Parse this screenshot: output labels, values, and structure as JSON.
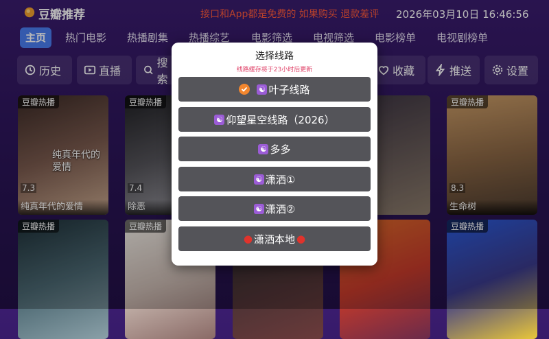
{
  "header": {
    "app_title": "豆瓣推荐",
    "notice": "接口和App都是免费的 如果购买 退款差评",
    "clock": "2026年03月10日 16:46:56"
  },
  "nav": {
    "tabs": [
      "主页",
      "热门电影",
      "热播剧集",
      "热播综艺",
      "电影筛选",
      "电视筛选",
      "电影榜单",
      "电视剧榜单"
    ]
  },
  "toolbar": {
    "history": "历史",
    "live": "直播",
    "search": "搜索",
    "favorite": "收藏",
    "push": "推送",
    "settings": "设置"
  },
  "cards": {
    "row1": [
      {
        "tag": "豆瓣热播",
        "score": "7.3",
        "name": "纯真年代的爱情",
        "poster_text": "纯真年代的爱情"
      },
      {
        "tag": "豆瓣热播",
        "score": "7.4",
        "name": "除恶",
        "poster_text": ""
      },
      {
        "tag": "",
        "score": "",
        "name": "",
        "poster_text": ""
      },
      {
        "tag": "",
        "score": "",
        "name": "",
        "poster_text": ""
      },
      {
        "tag": "",
        "score": "",
        "name": "",
        "poster_text": ""
      },
      {
        "tag": "豆瓣热播",
        "score": "8.3",
        "name": "生命树",
        "poster_text": ""
      }
    ],
    "row2": [
      {
        "tag": "豆瓣热播"
      },
      {
        "tag": "豆瓣热播"
      },
      {
        "tag": ""
      },
      {
        "tag": ""
      },
      {
        "tag": ""
      },
      {
        "tag": "豆瓣热播"
      }
    ]
  },
  "dialog": {
    "title": "选择线路",
    "subtitle": "线路缓存将于23小时后更新",
    "routes": [
      {
        "label": "叶子线路",
        "selected": true
      },
      {
        "label": "仰望星空线路（2026）",
        "selected": false
      },
      {
        "label": "多多",
        "selected": false
      },
      {
        "label": "潇洒①",
        "selected": false
      },
      {
        "label": "潇洒②",
        "selected": false
      },
      {
        "label": "潇洒本地",
        "selected": false
      }
    ]
  },
  "colors": {
    "accent": "#4a7df0",
    "notice": "#ff5a3c",
    "check": "#f2862e",
    "route_bg": "#545459"
  }
}
